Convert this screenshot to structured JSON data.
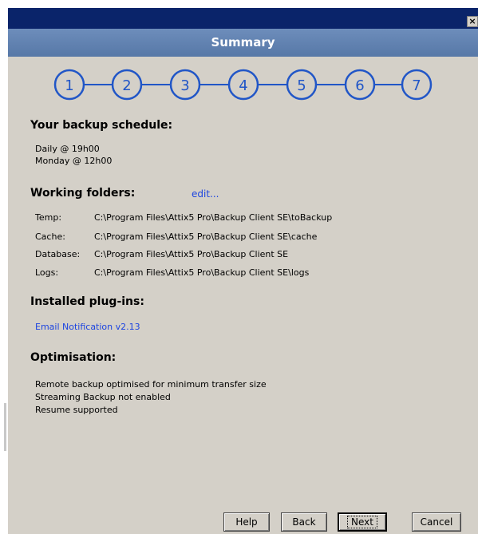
{
  "window": {
    "close_glyph": "×"
  },
  "header": {
    "title": "Summary"
  },
  "steps": [
    "1",
    "2",
    "3",
    "4",
    "5",
    "6",
    "7"
  ],
  "colors": {
    "step": "#2156c7",
    "link": "#1c44e0",
    "header": "#5f80b0",
    "titlebar": "#0a246a"
  },
  "schedule": {
    "title": "Your backup schedule:",
    "items": [
      "Daily @ 19h00",
      "Monday @ 12h00"
    ]
  },
  "folders": {
    "title": "Working folders:",
    "edit_label": "edit...",
    "rows": [
      {
        "label": "Temp:",
        "path": "C:\\Program Files\\Attix5 Pro\\Backup Client SE\\toBackup"
      },
      {
        "label": "Cache:",
        "path": "C:\\Program Files\\Attix5 Pro\\Backup Client SE\\cache"
      },
      {
        "label": "Database:",
        "path": "C:\\Program Files\\Attix5 Pro\\Backup Client SE"
      },
      {
        "label": "Logs:",
        "path": "C:\\Program Files\\Attix5 Pro\\Backup Client SE\\logs"
      }
    ]
  },
  "plugins": {
    "title": "Installed plug-ins:",
    "items": [
      "Email Notification v2.13"
    ]
  },
  "optimisation": {
    "title": "Optimisation:",
    "items": [
      "Remote backup optimised for minimum transfer size",
      "Streaming Backup not enabled",
      "Resume supported"
    ]
  },
  "buttons": {
    "help": "Help",
    "back": "Back",
    "next": "Next",
    "cancel": "Cancel"
  }
}
